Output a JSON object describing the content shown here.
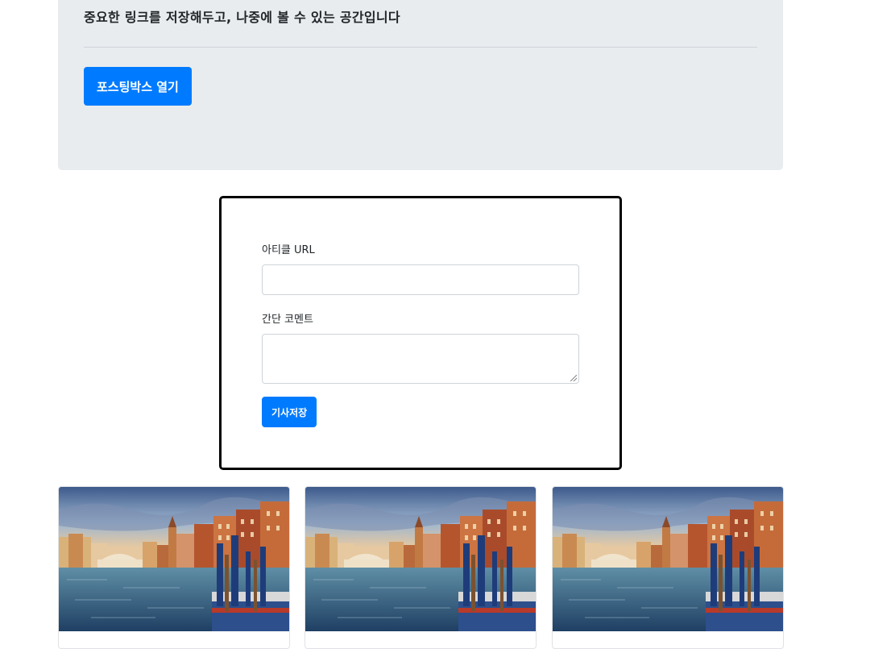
{
  "jumbotron": {
    "lead_text": "중요한 링크를 저장해두고, 나중에 볼 수 있는 공간입니다",
    "open_button_label": "포스팅박스 열기"
  },
  "posting_box": {
    "url_label": "아티클 URL",
    "url_value": "",
    "comment_label": "간단 코멘트",
    "comment_value": "",
    "save_button_label": "기사저장"
  },
  "cards": [
    {
      "image": "venice-canal-photo"
    },
    {
      "image": "venice-canal-photo"
    },
    {
      "image": "venice-canal-photo"
    }
  ],
  "colors": {
    "primary": "#007bff",
    "jumbotron_bg": "#e9ecef"
  }
}
